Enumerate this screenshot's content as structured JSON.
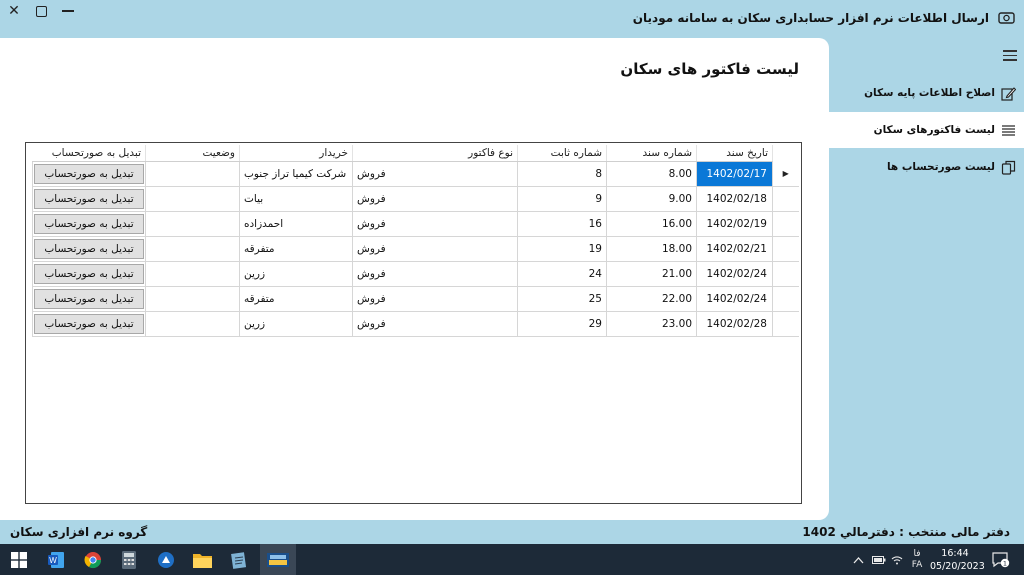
{
  "window": {
    "title": "ارسال اطلاعات نرم افزار حسابداری سکان به سامانه مودیان",
    "close_glyph": "✕"
  },
  "page": {
    "title": "لیست فاکتور های سکان"
  },
  "sidebar": {
    "items": [
      {
        "label": "اصلاح اطلاعات پایه سکان",
        "icon": "edit-icon",
        "active": false
      },
      {
        "label": "لیست فاکتورهای سکان",
        "icon": "list-icon",
        "active": true
      },
      {
        "label": "لیست صورتحساب ها",
        "icon": "copy-icon",
        "active": false
      }
    ]
  },
  "grid": {
    "columns": {
      "date": "تاریخ سند",
      "doc_no": "شماره سند",
      "fixed_no": "شماره ثابت",
      "invoice_type": "نوع فاکتور",
      "buyer": "خریدار",
      "status": "وضعیت",
      "convert": "تبدیل به صورتحساب"
    },
    "row_indicator": "▶",
    "rows": [
      {
        "date": "1402/02/17",
        "doc_no": "8.00",
        "fixed_no": "8",
        "invoice_type": "فروش",
        "buyer": "شرکت کیمیا تراز جنوب",
        "status": "",
        "convert": "تبدیل به صورتحساب",
        "selected": true
      },
      {
        "date": "1402/02/18",
        "doc_no": "9.00",
        "fixed_no": "9",
        "invoice_type": "فروش",
        "buyer": "بیات",
        "status": "",
        "convert": "تبدیل به صورتحساب",
        "selected": false
      },
      {
        "date": "1402/02/19",
        "doc_no": "16.00",
        "fixed_no": "16",
        "invoice_type": "فروش",
        "buyer": "احمدزاده",
        "status": "",
        "convert": "تبدیل به صورتحساب",
        "selected": false
      },
      {
        "date": "1402/02/21",
        "doc_no": "18.00",
        "fixed_no": "19",
        "invoice_type": "فروش",
        "buyer": "متفرقه",
        "status": "",
        "convert": "تبدیل به صورتحساب",
        "selected": false
      },
      {
        "date": "1402/02/24",
        "doc_no": "21.00",
        "fixed_no": "24",
        "invoice_type": "فروش",
        "buyer": "زرین",
        "status": "",
        "convert": "تبدیل به صورتحساب",
        "selected": false
      },
      {
        "date": "1402/02/24",
        "doc_no": "22.00",
        "fixed_no": "25",
        "invoice_type": "فروش",
        "buyer": "متفرقه",
        "status": "",
        "convert": "تبدیل به صورتحساب",
        "selected": false
      },
      {
        "date": "1402/02/28",
        "doc_no": "23.00",
        "fixed_no": "29",
        "invoice_type": "فروش",
        "buyer": "زرین",
        "status": "",
        "convert": "تبدیل به صورتحساب",
        "selected": false
      }
    ]
  },
  "status_bar": {
    "company": "گروه نرم افزاری سکان",
    "fiscal_year": "دفتر مالی منتخب : دفترمالي 1402"
  },
  "taskbar": {
    "time": "16:44",
    "date": "05/20/2023",
    "lang_top": "فا",
    "lang_bottom": "FA",
    "notification_count": "1",
    "apps": [
      "windows-start-icon",
      "word-icon",
      "chrome-icon",
      "calculator-icon",
      "app-icon",
      "file-explorer-icon",
      "notepad-icon",
      "sakan-app-icon"
    ]
  },
  "colors": {
    "background": "#acd6e6",
    "selection": "#0a78d7",
    "taskbar": "#1d2a38"
  }
}
